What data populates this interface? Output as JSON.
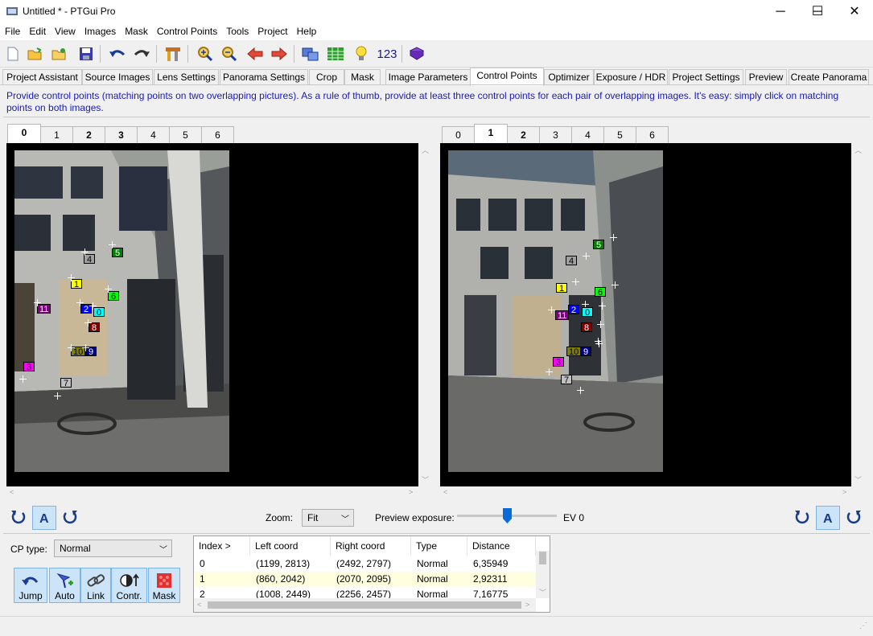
{
  "window": {
    "title": "Untitled * - PTGui Pro",
    "min": "─",
    "max": "☐",
    "close": "✕"
  },
  "menu": [
    "File",
    "Edit",
    "View",
    "Images",
    "Mask",
    "Control Points",
    "Tools",
    "Project",
    "Help"
  ],
  "toolbar": {
    "counter": "123",
    "icons": [
      "new-project-icon",
      "open-project-icon",
      "open-images-icon",
      "save-icon",
      "undo-icon",
      "redo-icon",
      "tools-icon",
      "zoom-in-icon",
      "zoom-out-icon",
      "previous-icon",
      "next-icon",
      "panorama-editor-icon",
      "table-icon",
      "bulb-icon",
      "number-icon",
      "help-book-icon"
    ]
  },
  "tabs": [
    "Project Assistant",
    "Source Images",
    "Lens Settings",
    "Panorama Settings",
    "Crop",
    "Mask",
    "Image Parameters",
    "Control Points",
    "Optimizer",
    "Exposure / HDR",
    "Project Settings",
    "Preview",
    "Create Panorama"
  ],
  "active_tab": "Control Points",
  "hint": "Provide control points (matching points on two overlapping pictures). As a rule of thumb, provide at least three control points for each pair of overlapping images. It's easy: simply click on matching points on both images.",
  "left_image_tabs": [
    "0",
    "1",
    "2",
    "3",
    "4",
    "5",
    "6"
  ],
  "left_active": "0",
  "right_image_tabs": [
    "0",
    "1",
    "2",
    "3",
    "4",
    "5",
    "6"
  ],
  "right_active": "1",
  "left_points": [
    {
      "id": "4",
      "color": "#a0a0a0",
      "fg": "#000"
    },
    {
      "id": "5",
      "color": "#008000",
      "fg": "#fff"
    },
    {
      "id": "1",
      "color": "#ffff00",
      "fg": "#000"
    },
    {
      "id": "6",
      "color": "#00ff00",
      "fg": "#000"
    },
    {
      "id": "11",
      "color": "#800080",
      "fg": "#fff"
    },
    {
      "id": "2",
      "color": "#0000ff",
      "fg": "#fff"
    },
    {
      "id": "0",
      "color": "#00ffff",
      "fg": "#000"
    },
    {
      "id": "8",
      "color": "#800000",
      "fg": "#fff"
    },
    {
      "id": "10",
      "color": "#808000",
      "fg": "#000"
    },
    {
      "id": "9",
      "color": "#000080",
      "fg": "#fff"
    },
    {
      "id": "3",
      "color": "#ff00ff",
      "fg": "#000"
    },
    {
      "id": "7",
      "color": "#c0c0c0",
      "fg": "#000"
    }
  ],
  "right_points": [
    {
      "id": "5",
      "color": "#008000",
      "fg": "#fff"
    },
    {
      "id": "4",
      "color": "#a0a0a0",
      "fg": "#000"
    },
    {
      "id": "1",
      "color": "#ffff00",
      "fg": "#000"
    },
    {
      "id": "6",
      "color": "#00ff00",
      "fg": "#000"
    },
    {
      "id": "2",
      "color": "#0000ff",
      "fg": "#fff"
    },
    {
      "id": "0",
      "color": "#00ffff",
      "fg": "#000"
    },
    {
      "id": "11",
      "color": "#800080",
      "fg": "#fff"
    },
    {
      "id": "8",
      "color": "#800000",
      "fg": "#fff"
    },
    {
      "id": "10",
      "color": "#808000",
      "fg": "#000"
    },
    {
      "id": "9",
      "color": "#000080",
      "fg": "#fff"
    },
    {
      "id": "3",
      "color": "#ff00ff",
      "fg": "#000"
    },
    {
      "id": "7",
      "color": "#c0c0c0",
      "fg": "#000"
    }
  ],
  "zoom": {
    "label": "Zoom:",
    "value": "Fit"
  },
  "preview_exposure": {
    "label": "Preview exposure:",
    "value": "EV 0",
    "level": 0.5
  },
  "cp_type": {
    "label": "CP type:",
    "value": "Normal"
  },
  "bottom_buttons": [
    "Jump",
    "Auto",
    "Link",
    "Contr.",
    "Mask"
  ],
  "table": {
    "headers": [
      "Index >",
      "Left coord",
      "Right coord",
      "Type",
      "Distance"
    ],
    "rows": [
      [
        "0",
        "(1199, 2813)",
        "(2492, 2797)",
        "Normal",
        "6,35949"
      ],
      [
        "1",
        "(860, 2042)",
        "(2070, 2095)",
        "Normal",
        "2,92311"
      ],
      [
        "2",
        "(1008, 2449)",
        "(2256, 2457)",
        "Normal",
        "7,16775"
      ]
    ]
  }
}
